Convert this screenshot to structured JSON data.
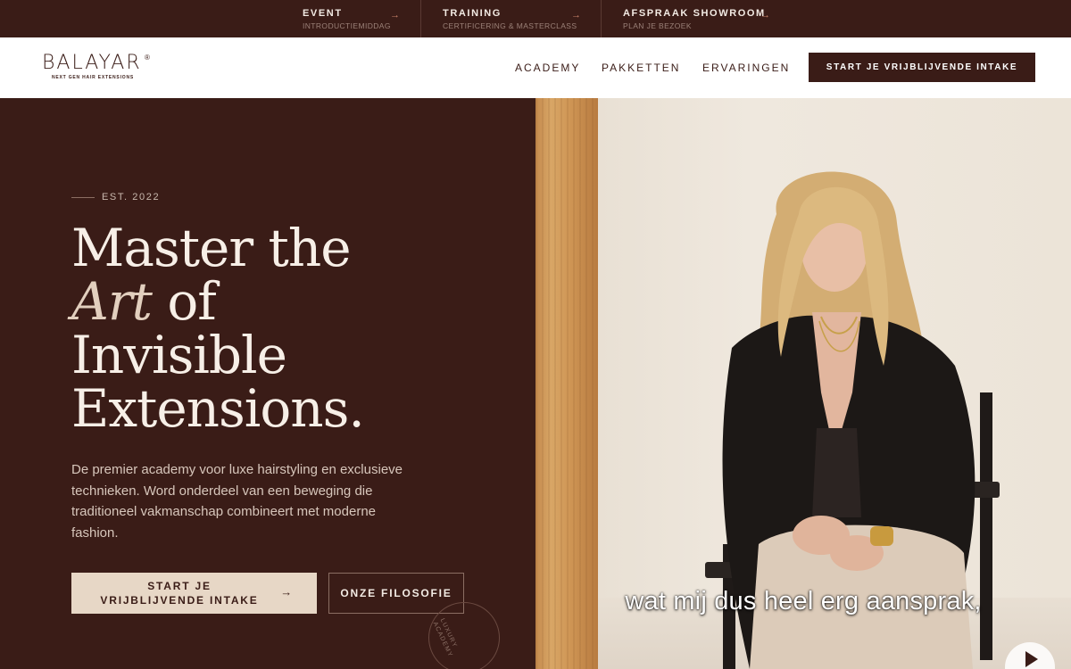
{
  "topbar": {
    "promos": [
      {
        "title": "EVENT",
        "subtitle": "INTRODUCTIEMIDDAG",
        "icon": "arrow-right-icon"
      },
      {
        "title": "TRAINING",
        "subtitle": "CERTIFICERING & MASTERCLASS",
        "icon": "arrow-right-icon"
      },
      {
        "title": "AFSPRAAK SHOWROOM",
        "subtitle": "PLAN JE BEZOEK",
        "icon": "arrow-right-icon"
      }
    ]
  },
  "nav": {
    "logo_text": "BALAYAR",
    "logo_registered": "®",
    "logo_tagline": "NEXT GEN HAIR EXTENSIONS",
    "links": [
      "ACADEMY",
      "PAKKETTEN",
      "ERVARINGEN"
    ],
    "cta": "START JE VRIJBLIJVENDE INTAKE"
  },
  "hero": {
    "established": "EST. 2022",
    "headline": {
      "line1": "Master the",
      "line2_italic": "Art",
      "line2_rest": " of",
      "line3": "Invisible",
      "line4": "Extensions."
    },
    "lede": "De premier academy voor luxe hairstyling en exclusieve technieken. Word onderdeel van een beweging die traditioneel vakmanschap combineert met moderne fashion.",
    "primary_button": "START JE VRIJBLIJVENDE INTAKE",
    "primary_button_icon": "arrow-right-icon",
    "secondary_button": "ONZE FILOSOFIE",
    "badge_text": "LUXURY ACADEMY"
  },
  "video": {
    "subtitle": "wat mij dus heel erg aansprak,",
    "play_icon": "play-icon"
  },
  "colors": {
    "brand_dark": "#3a1c17",
    "cream": "#e7d7c6",
    "accent_arrow": "#c8826a"
  }
}
